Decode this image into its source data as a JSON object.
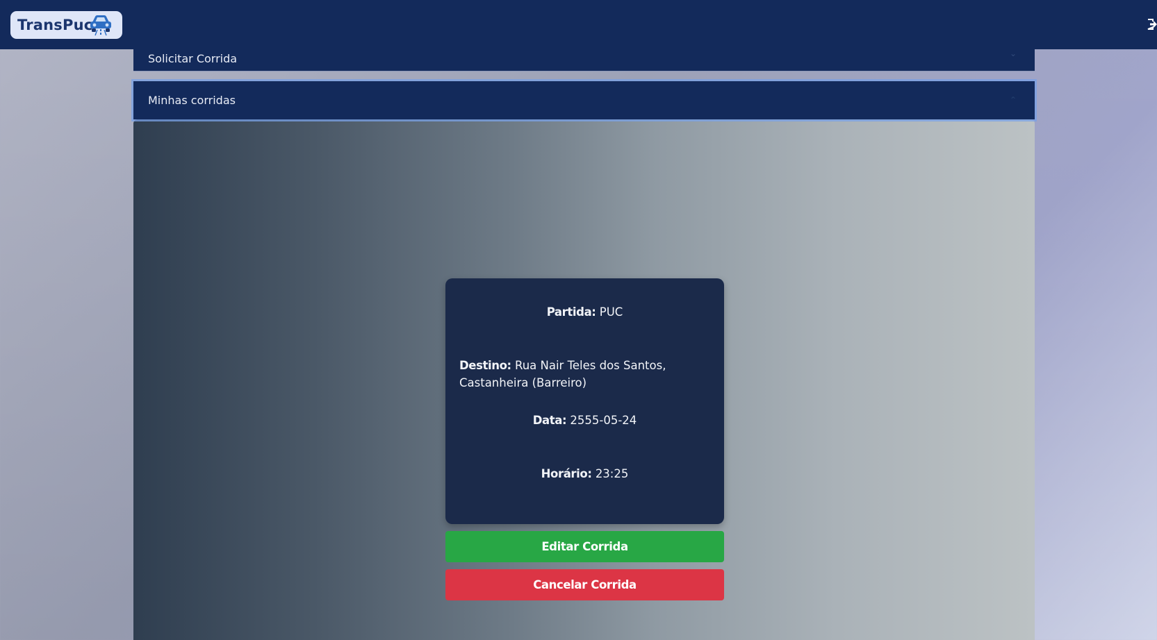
{
  "app": {
    "logo_text": "TransPuc",
    "logo_icon": "car-icon",
    "logout_icon": "logout-icon"
  },
  "accordion": {
    "request_ride_label": "Solicitar Corrida",
    "my_rides_label": "Minhas corridas"
  },
  "ride": {
    "departure_label": "Partida:",
    "departure_value": "PUC",
    "destination_label": "Destino:",
    "destination_value": "Rua Nair Teles dos Santos, Castanheira (Barreiro)",
    "date_label": "Data:",
    "date_value": "2555-05-24",
    "time_label": "Horário:",
    "time_value": "23:25",
    "edit_button": "Editar Corrida",
    "cancel_button": "Cancelar Corrida"
  },
  "colors": {
    "navbar": "#132a5b",
    "card": "#1b2a4a",
    "edit": "#28a745",
    "cancel": "#dc3545"
  }
}
